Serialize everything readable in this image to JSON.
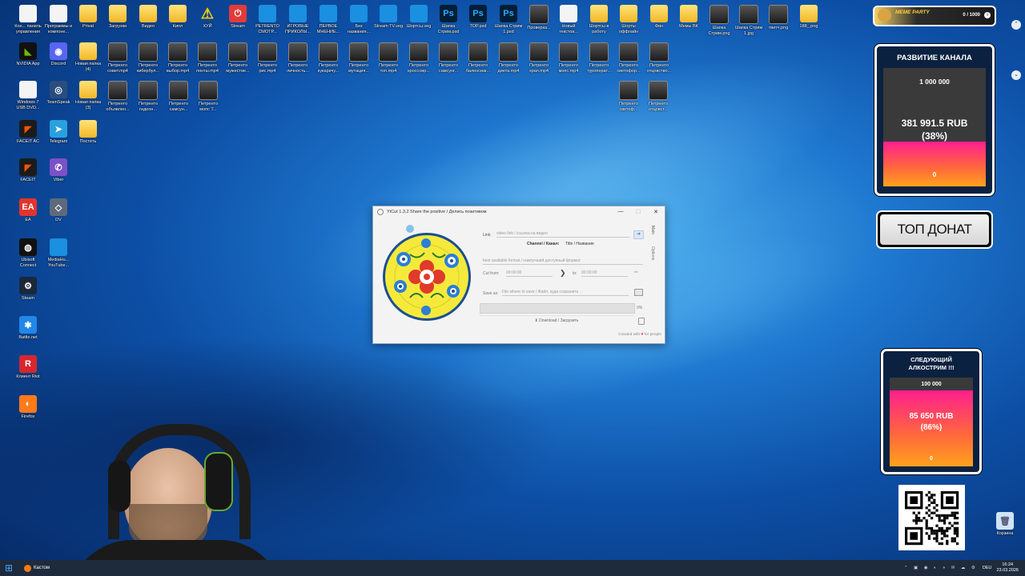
{
  "desktop": {
    "icons": [
      {
        "label": "Кон... панель управления",
        "type": "file"
      },
      {
        "label": "Программы и компоне...",
        "type": "file"
      },
      {
        "label": "Privat",
        "type": "folder"
      },
      {
        "label": "Загрузки",
        "type": "folder"
      },
      {
        "label": "Видео",
        "type": "folder"
      },
      {
        "label": "Кипл",
        "type": "folder"
      },
      {
        "label": "ХУЙ",
        "type": "warn"
      },
      {
        "label": "Stream",
        "type": "stream"
      },
      {
        "label": "PETRENTO СМОТР...",
        "type": "doc"
      },
      {
        "label": "ИГРОВЫЕ ПРИКОЛЫ...",
        "type": "doc"
      },
      {
        "label": "ПЕРВОЕ МНЕНИЕ...",
        "type": "doc"
      },
      {
        "label": "Без названия...",
        "type": "doc"
      },
      {
        "label": "Stream TV.veg",
        "type": "doc"
      },
      {
        "label": "Шортсы.veg",
        "type": "doc"
      },
      {
        "label": "Шапка Стрим.psd",
        "type": "ps"
      },
      {
        "label": "TOP.psd",
        "type": "ps"
      },
      {
        "label": "Шапка Стрим 1.psd",
        "type": "ps"
      },
      {
        "label": "Проверка...",
        "type": "vid"
      },
      {
        "label": "Новый текстов...",
        "type": "file"
      },
      {
        "label": "Шортсы в работу",
        "type": "folder"
      },
      {
        "label": "Шорты оффлайн",
        "type": "folder"
      },
      {
        "label": "Фин",
        "type": "folder"
      },
      {
        "label": "Мемы ВК",
        "type": "folder"
      },
      {
        "label": "Шапка Стрим.png",
        "type": "vid"
      },
      {
        "label": "Шапка Стрим 1.jpg",
        "type": "vid"
      },
      {
        "label": "твитч.png",
        "type": "vid"
      },
      {
        "label": "188_.png",
        "type": "folder"
      },
      {
        "label": "NVIDIA App",
        "type": "nvidia"
      },
      {
        "label": "Discord",
        "type": "discord"
      },
      {
        "label": "Новая папка (4)",
        "type": "folder"
      },
      {
        "label": "Петренто совет.mp4",
        "type": "vid"
      },
      {
        "label": "Петренто кибербул...",
        "type": "vid"
      },
      {
        "label": "Петренто выбор.mp4",
        "type": "vid"
      },
      {
        "label": "Петренто понты.mp4",
        "type": "vid"
      },
      {
        "label": "Петренто мужестве...",
        "type": "vid"
      },
      {
        "label": "Петренто рис.mp4",
        "type": "vid"
      },
      {
        "label": "Петренто личность...",
        "type": "vid"
      },
      {
        "label": "Петренто кукаречу...",
        "type": "vid"
      },
      {
        "label": "Петренто мутация...",
        "type": "vid"
      },
      {
        "label": "Петренто топ.mp4",
        "type": "vid"
      },
      {
        "label": "Петренто кроссовр...",
        "type": "vid"
      },
      {
        "label": "Петренто самсунг...",
        "type": "vid"
      },
      {
        "label": "Петренто баленсиаг...",
        "type": "vid"
      },
      {
        "label": "Петренто диета.mp4",
        "type": "vid"
      },
      {
        "label": "Петренто храп.mp4",
        "type": "vid"
      },
      {
        "label": "Петренто мопс.mp4",
        "type": "vid"
      },
      {
        "label": "Петренто туроперат...",
        "type": "vid"
      },
      {
        "label": "Петренто светофор...",
        "type": "vid"
      },
      {
        "label": "Петренто отцовство...",
        "type": "vid"
      },
      {
        "label": "Windows 7 USB DVD...",
        "type": "file"
      },
      {
        "label": "TeamSpeak",
        "type": "ts"
      },
      {
        "label": "Новая папка (3)",
        "type": "folder"
      },
      {
        "label": "Петренто объявлен...",
        "type": "vid"
      },
      {
        "label": "Петренто гидеон...",
        "type": "vid"
      },
      {
        "label": "Петренто самсун...",
        "type": "vid"
      },
      {
        "label": "Петренто мопс Т...",
        "type": "vid"
      },
      {
        "label": "Петренто светоф...",
        "type": "vid"
      },
      {
        "label": "Петренто отцовст...",
        "type": "vid"
      },
      {
        "label": "FACEIT AC",
        "type": "faceit"
      },
      {
        "label": "Telegram",
        "type": "telegram"
      },
      {
        "label": "Постить",
        "type": "folder"
      },
      {
        "label": "FACEIT",
        "type": "faceit"
      },
      {
        "label": "Viber",
        "type": "viber"
      },
      {
        "label": "EA",
        "type": "ea"
      },
      {
        "label": "DV",
        "type": "dv"
      },
      {
        "label": "Ubisoft Connect",
        "type": "ubi"
      },
      {
        "label": "MediaHu... YouTube...",
        "type": "doc"
      },
      {
        "label": "Steam",
        "type": "steam"
      },
      {
        "label": "Battle.net",
        "type": "bnet"
      },
      {
        "label": "Клиент Riot",
        "type": "riot"
      },
      {
        "label": "Firefox",
        "type": "firefox"
      },
      {
        "label": "Корзина",
        "type": "recycle"
      }
    ]
  },
  "app": {
    "title": "YtCut 1.3.2 Share the positive / Делись позитивом",
    "min_btn": "—",
    "max_btn": "☐",
    "close_btn": "✕",
    "side_tabs": [
      "Main",
      "Options"
    ],
    "link_label": "Link:",
    "link_placeholder": "video link / ссылка на видео",
    "channel_label": "Channel / Канал:",
    "title_label": "Title / Название",
    "format_value": "best available format / наилучший доступный формат",
    "cut_from_label": "Cut from:",
    "cut_from_value": "00:00:00",
    "to_label": "to:",
    "to_value": "00:00:00",
    "save_as_label": "Save as:",
    "save_as_placeholder": "File where to save / Файл, куда сохранить",
    "progress_percent": 0,
    "progress_text": "0%",
    "download_label": "Download / Загрузить",
    "footer_text": "Created with",
    "footer_text2": "for people"
  },
  "widgets": {
    "meme_party": {
      "title": "MEME PARTY",
      "count": "0 / 1000"
    },
    "channel_goal": {
      "title": "РАЗВИТИЕ КАНАЛА",
      "goal": "1 000 000",
      "current": "381 991.5 RUB",
      "percent_text": "(38%)",
      "fraction": 0.38,
      "start": "0"
    },
    "top_donate": {
      "label": "ТОП ДОНАТ"
    },
    "next_stream": {
      "title": "СЛЕДУЮЩИЙ АЛКОСТРИМ !!!",
      "goal": "100 000",
      "current": "85 650 RUB",
      "percent_text": "(86%)",
      "fraction": 0.86,
      "start": "0"
    }
  },
  "taskbar": {
    "app_label": "Кастом",
    "tray": {
      "lang": "DEU",
      "time": "16:24",
      "date": "23.03.2026"
    }
  },
  "colors": {
    "accent": "#ff1f8e",
    "goal_fill_end": "#ffa21c",
    "panel_bg": "#0b2140"
  }
}
